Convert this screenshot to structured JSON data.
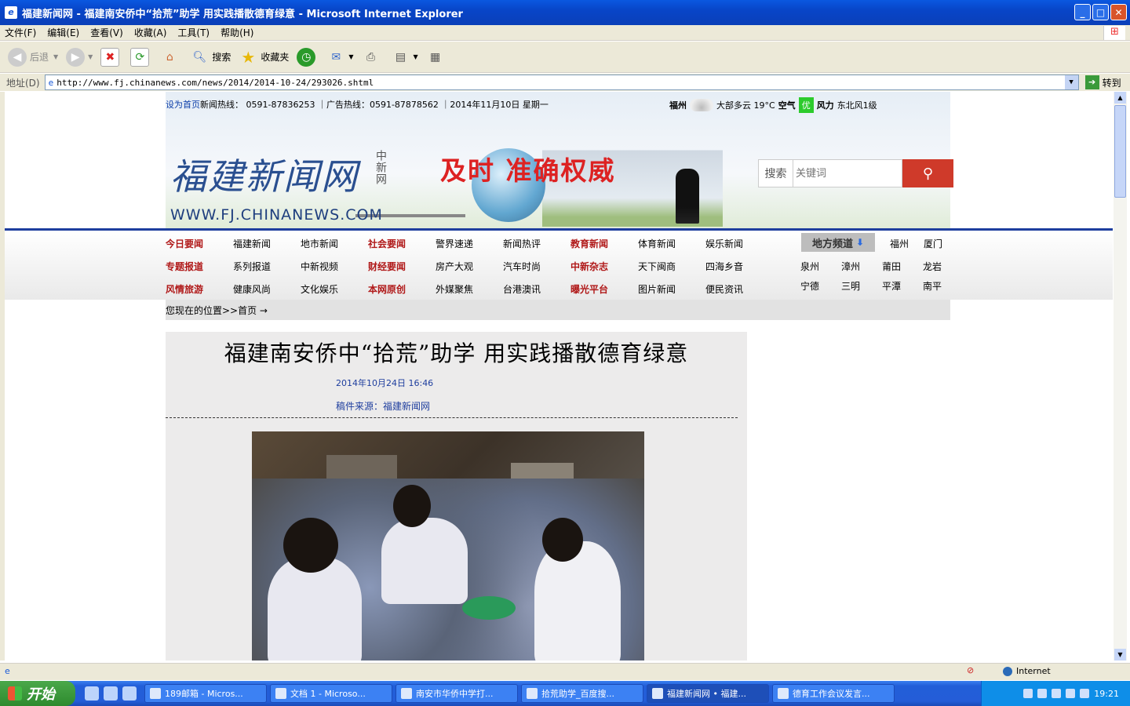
{
  "window": {
    "title": "福建新闻网 - 福建南安侨中“拾荒”助学 用实践播散德育绿意 - Microsoft Internet Explorer",
    "buttons": [
      "_",
      "□",
      "✕"
    ]
  },
  "menu": [
    "文件(F)",
    "编辑(E)",
    "查看(V)",
    "收藏(A)",
    "工具(T)",
    "帮助(H)"
  ],
  "toolbar": {
    "back": "后退",
    "search": "搜索",
    "favorites": "收藏夹"
  },
  "address": {
    "label": "地址(D)",
    "url": "http://www.fj.chinanews.com/news/2014/2014-10-24/293026.shtml",
    "go": "转到"
  },
  "header": {
    "set_home": "设为首页",
    "hotline": "新闻热线： 0591-87836253 ｜广告热线：0591-87878562 ｜2014年11月10日 星期一",
    "city": "福州",
    "weather": "大部多云 19°C",
    "air_label": "空气",
    "air_value": "优",
    "wind_label": "风力",
    "wind_value": "东北风1级",
    "logo": "福建新闻网",
    "logo_sub": "中新网",
    "url": "WWW.FJ.CHINANEWS.COM",
    "slogan": "及时 准确权威",
    "search_label": "搜索",
    "search_placeholder": "关键词"
  },
  "nav": {
    "rows": [
      [
        {
          "t": "今日要闻",
          "red": true
        },
        {
          "t": "福建新闻"
        },
        {
          "t": "地市新闻"
        },
        {
          "t": "社会要闻",
          "red": true
        },
        {
          "t": "警界速递"
        },
        {
          "t": "新闻热评"
        },
        {
          "t": "教育新闻",
          "red": true
        },
        {
          "t": "体育新闻"
        },
        {
          "t": "娱乐新闻"
        }
      ],
      [
        {
          "t": "专题报道",
          "red": true
        },
        {
          "t": "系列报道"
        },
        {
          "t": "中新视频"
        },
        {
          "t": "财经要闻",
          "red": true
        },
        {
          "t": "房产大观"
        },
        {
          "t": "汽车时尚"
        },
        {
          "t": "中新杂志",
          "red": true
        },
        {
          "t": "天下闽商"
        },
        {
          "t": "四海乡音"
        }
      ],
      [
        {
          "t": "风情旅游",
          "red": true
        },
        {
          "t": "健康风尚"
        },
        {
          "t": "文化娱乐"
        },
        {
          "t": "本网原创",
          "red": true
        },
        {
          "t": "外媒聚焦"
        },
        {
          "t": "台港澳讯"
        },
        {
          "t": "曝光平台",
          "red": true
        },
        {
          "t": "图片新闻"
        },
        {
          "t": "便民资讯"
        }
      ]
    ],
    "local_label": "地方频道",
    "local_cities": [
      "福州",
      "厦门",
      "泉州",
      "漳州",
      "莆田",
      "龙岩",
      "宁德",
      "三明",
      "平潭",
      "南平"
    ]
  },
  "breadcrumb": "您现在的位置>>首页 →",
  "article": {
    "title": "福建南安侨中“拾荒”助学 用实践播散德育绿意",
    "date": "2014年10月24日 16:46",
    "source": "稿件来源：福建新闻网"
  },
  "status": {
    "zone": "Internet"
  },
  "taskbar": {
    "start": "开始",
    "tasks": [
      "189邮箱 - Micros...",
      "文档 1 - Microso...",
      "南安市华侨中学打...",
      "拾荒助学_百度搜...",
      "福建新闻网 • 福建...",
      "德育工作会议发言..."
    ],
    "clock": "19:21"
  }
}
